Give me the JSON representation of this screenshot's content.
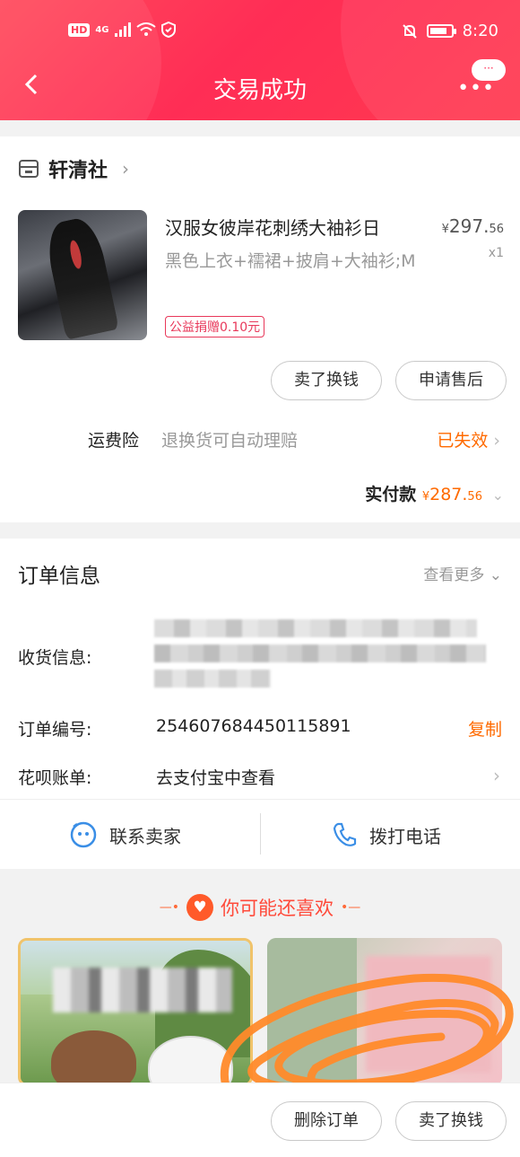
{
  "status_bar": {
    "hd": "HD",
    "network": "4G",
    "time": "8:20"
  },
  "nav": {
    "title": "交易成功",
    "more_badge": "···"
  },
  "shop": {
    "name": "轩清社"
  },
  "product": {
    "title": "汉服女彼岸花刺绣大袖衫日",
    "spec": "黑色上衣+襦裙+披肩+大袖衫;M",
    "price_symbol": "¥",
    "price_main": "297.",
    "price_cents": "56",
    "qty": "x1",
    "charity": "公益捐赠0.10元"
  },
  "item_actions": {
    "sell": "卖了换钱",
    "after_sale": "申请售后"
  },
  "shipping_insurance": {
    "label": "运费险",
    "desc": "退换货可自动理赔",
    "status": "已失效"
  },
  "paid": {
    "label": "实付款",
    "symbol": "¥",
    "main": "287.",
    "cents": "56"
  },
  "order_info": {
    "title": "订单信息",
    "more": "查看更多",
    "address_label": "收货信息:",
    "order_no_label": "订单编号:",
    "order_no": "254607684450115891",
    "copy": "复制",
    "huabei_label": "花呗账单:",
    "huabei_value": "去支付宝中查看"
  },
  "contact": {
    "seller": "联系卖家",
    "phone": "拨打电话"
  },
  "recommend": {
    "title": "你可能还喜欢"
  },
  "bottom_actions": {
    "delete": "删除订单",
    "sell": "卖了换钱"
  },
  "colors": {
    "brand": "#ff2d55",
    "accent": "#ff6a00"
  }
}
